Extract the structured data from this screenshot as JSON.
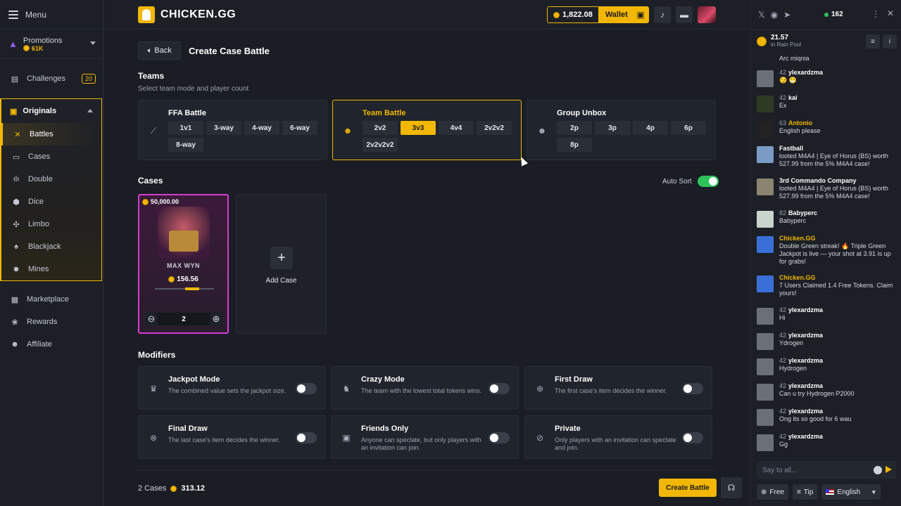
{
  "sidebar": {
    "menu_label": "Menu",
    "promotions": {
      "label": "Promotions",
      "value": "61K"
    },
    "challenges": {
      "label": "Challenges",
      "badge": "20"
    },
    "originals": {
      "label": "Originals",
      "items": [
        {
          "label": "Battles",
          "icon": "swords-icon",
          "active": true
        },
        {
          "label": "Cases",
          "icon": "case-icon"
        },
        {
          "label": "Double",
          "icon": "double-bars-icon"
        },
        {
          "label": "Dice",
          "icon": "dice-icon"
        },
        {
          "label": "Limbo",
          "icon": "limbo-icon"
        },
        {
          "label": "Blackjack",
          "icon": "cards-icon"
        },
        {
          "label": "Mines",
          "icon": "mines-icon"
        }
      ]
    },
    "bottom": [
      {
        "label": "Marketplace",
        "icon": "store-icon"
      },
      {
        "label": "Rewards",
        "icon": "rewards-icon"
      },
      {
        "label": "Affiliate",
        "icon": "affiliate-icon"
      }
    ]
  },
  "topbar": {
    "brand": "CHICKEN.GG",
    "balance": "1,822.08",
    "wallet_label": "Wallet"
  },
  "page": {
    "back_label": "Back",
    "title": "Create Case Battle",
    "teams_title": "Teams",
    "teams_sub": "Select team mode and player count",
    "modes": [
      {
        "title": "FFA Battle",
        "icon": "knife-icon",
        "options": [
          "1v1",
          "3-way",
          "4-way",
          "6-way",
          "8-way"
        ],
        "selected": null
      },
      {
        "title": "Team Battle",
        "icon": "team-icon",
        "options": [
          "2v2",
          "3v3",
          "4v4",
          "2v2v2",
          "2v2v2v2"
        ],
        "selected": 1
      },
      {
        "title": "Group Unbox",
        "icon": "group-icon",
        "options": [
          "2p",
          "3p",
          "4p",
          "6p",
          "8p"
        ],
        "selected": null
      }
    ],
    "cases_title": "Cases",
    "auto_sort_label": "Auto Sort",
    "auto_sort_on": true,
    "case": {
      "top_price": "50,000.00",
      "name": "MAX WYN",
      "price": "156.56",
      "quantity": "2"
    },
    "add_case_label": "Add Case",
    "modifiers_title": "Modifiers",
    "modifiers": [
      {
        "title": "Jackpot Mode",
        "desc": "The combined value sets the jackpot size.",
        "icon": "crown-icon",
        "on": false
      },
      {
        "title": "Crazy Mode",
        "desc": "The team with the lowest total tokens wins.",
        "icon": "chicken-icon",
        "on": false
      },
      {
        "title": "First Draw",
        "desc": "The first case's item decides the winner.",
        "icon": "crosshair-icon",
        "on": false
      },
      {
        "title": "Final Draw",
        "desc": "The last case's item decides the winner.",
        "icon": "target-icon",
        "on": false
      },
      {
        "title": "Friends Only",
        "desc": "Anyone can spectate, but only players with an invitation can join.",
        "icon": "lock-icon",
        "on": false
      },
      {
        "title": "Private",
        "desc": "Only players with an invitation can spectate and join.",
        "icon": "eye-off-icon",
        "on": false
      }
    ],
    "footer": {
      "cases_count": "2 Cases",
      "total": "313.12",
      "create_label": "Create Battle"
    }
  },
  "chat": {
    "online": "162",
    "rain_amount": "21.57",
    "rain_label": "in Rain Pool",
    "messages": [
      {
        "user": "",
        "level": "",
        "text": "Arc miqnia"
      },
      {
        "user": "ylexardzma",
        "level": "42",
        "text": "😏 😁"
      },
      {
        "user": "kai",
        "level": "42",
        "text": "Ex"
      },
      {
        "user": "Antonio",
        "level": "63",
        "text": "English please",
        "gold": true
      },
      {
        "user": "Fastball",
        "level": "",
        "text": "looted M4A4 | Eye of Horus (BS) worth 527.99 from the 5% M4A4 case!"
      },
      {
        "user": "3rd Commando Company",
        "level": "",
        "text": "looted M4A4 | Eye of Horus (BS) worth 527.99 from the 5% M4A4 case!"
      },
      {
        "user": "Babyperc",
        "level": "82",
        "text": "Babyperc"
      },
      {
        "user": "Chicken.GG",
        "level": "",
        "text": "Double Green streak! 🔥 Triple Green Jackpot is live — your shot at 3.91 is up for grabs!",
        "gold": true
      },
      {
        "user": "Chicken.GG",
        "level": "",
        "text": "7 Users Claimed 1.4 Free Tokens. Claim yours!",
        "gold": true
      },
      {
        "user": "ylexardzma",
        "level": "42",
        "text": "Hi"
      },
      {
        "user": "ylexardzma",
        "level": "42",
        "text": "Ydrogen"
      },
      {
        "user": "ylexardzma",
        "level": "42",
        "text": "Hydrogen"
      },
      {
        "user": "ylexardzma",
        "level": "42",
        "text": "Can u try Hydrogen P2000"
      },
      {
        "user": "ylexardzma",
        "level": "42",
        "text": "Ong its so good for 6 wau"
      },
      {
        "user": "ylexardzma",
        "level": "42",
        "text": "Gg"
      }
    ],
    "input_placeholder": "Say to all...",
    "free_label": "Free",
    "tip_label": "Tip",
    "language": "English"
  }
}
